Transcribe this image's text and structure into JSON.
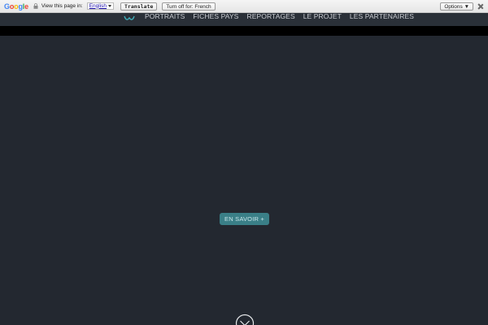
{
  "translate_bar": {
    "logo": "Google",
    "view_text": "View this page in:",
    "language": "English",
    "translate_label": "Translate",
    "turn_off_label": "Turn off for: French",
    "options_label": "Options ▼"
  },
  "nav": {
    "items": [
      "PORTRAITS",
      "FICHES PAYS",
      "REPORTAGES",
      "LE PROJET",
      "LES PARTENAIRES"
    ]
  },
  "hero": {
    "cta_label": "EN SAVOIR +"
  },
  "colors": {
    "background": "#232830",
    "accent": "#3a7f87"
  },
  "icons": [
    "lock-icon",
    "dropdown-arrow-icon",
    "close-icon",
    "site-logo-icon",
    "chevron-down-circle-icon"
  ]
}
